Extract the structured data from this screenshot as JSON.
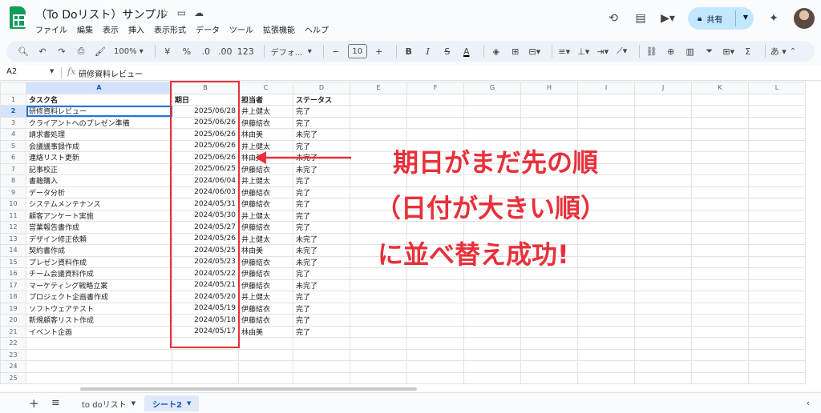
{
  "header": {
    "doc_title": "（To Doリスト）サンプル",
    "share_label": "共有",
    "menu": [
      "ファイル",
      "編集",
      "表示",
      "挿入",
      "表示形式",
      "データ",
      "ツール",
      "拡張機能",
      "ヘルプ"
    ]
  },
  "toolbar": {
    "zoom": "100%",
    "currency": "¥",
    "percent": "%",
    "dec_minus": ".0",
    "dec_plus": ".00",
    "number_format": "123",
    "font": "デフォ...",
    "font_size": "10",
    "input_method": "あ"
  },
  "formula_bar": {
    "cell_ref": "A2",
    "fx": "fx",
    "content": "研修資料レビュー"
  },
  "grid": {
    "columns": [
      "A",
      "B",
      "C",
      "D",
      "E",
      "F",
      "G",
      "H",
      "I",
      "J",
      "K",
      "L"
    ],
    "row_numbers": [
      "1",
      "2",
      "3",
      "4",
      "5",
      "6",
      "7",
      "8",
      "9",
      "10",
      "11",
      "12",
      "13",
      "14",
      "15",
      "16",
      "17",
      "18",
      "19",
      "20",
      "21",
      "22",
      "23",
      "24",
      "25"
    ],
    "header": [
      "タスク名",
      "期日",
      "担当者",
      "ステータス"
    ],
    "rows": [
      [
        "研修資料レビュー",
        "2025/06/28",
        "井上健太",
        "完了"
      ],
      [
        "クライアントへのプレゼン準備",
        "2025/06/26",
        "伊藤結衣",
        "完了"
      ],
      [
        "請求書処理",
        "2025/06/26",
        "林由美",
        "未完了"
      ],
      [
        "会議議事録作成",
        "2025/06/26",
        "井上健太",
        "完了"
      ],
      [
        "連絡リスト更新",
        "2025/06/26",
        "林由美",
        "未完了"
      ],
      [
        "記事校正",
        "2025/06/25",
        "伊藤結衣",
        "未完了"
      ],
      [
        "書籍購入",
        "2024/06/04",
        "井上健太",
        "完了"
      ],
      [
        "データ分析",
        "2024/06/03",
        "伊藤結衣",
        "完了"
      ],
      [
        "システムメンテナンス",
        "2024/05/31",
        "伊藤結衣",
        "完了"
      ],
      [
        "顧客アンケート実施",
        "2024/05/30",
        "井上健太",
        "完了"
      ],
      [
        "営業報告書作成",
        "2024/05/27",
        "伊藤結衣",
        "完了"
      ],
      [
        "デザイン修正依頼",
        "2024/05/26",
        "井上健太",
        "未完了"
      ],
      [
        "契約書作成",
        "2024/05/25",
        "林由美",
        "未完了"
      ],
      [
        "プレゼン資料作成",
        "2024/05/23",
        "伊藤結衣",
        "未完了"
      ],
      [
        "チーム会議資料作成",
        "2024/05/22",
        "伊藤結衣",
        "完了"
      ],
      [
        "マーケティング戦略立案",
        "2024/05/21",
        "伊藤結衣",
        "未完了"
      ],
      [
        "プロジェクト企画書作成",
        "2024/05/20",
        "井上健太",
        "完了"
      ],
      [
        "ソフトウェアテスト",
        "2024/05/19",
        "伊藤結衣",
        "完了"
      ],
      [
        "新規顧客リスト作成",
        "2024/05/18",
        "伊藤結衣",
        "完了"
      ],
      [
        "イベント企画",
        "2024/05/17",
        "林由美",
        "完了"
      ]
    ]
  },
  "annotation": {
    "line1": "期日がまだ先の順",
    "line2": "（日付が大きい順）",
    "line3": "に並べ替え成功!",
    "color": "#e8303a"
  },
  "sheets": {
    "tabs": [
      {
        "label": "to doリスト",
        "active": false
      },
      {
        "label": "シート2",
        "active": true
      }
    ]
  }
}
